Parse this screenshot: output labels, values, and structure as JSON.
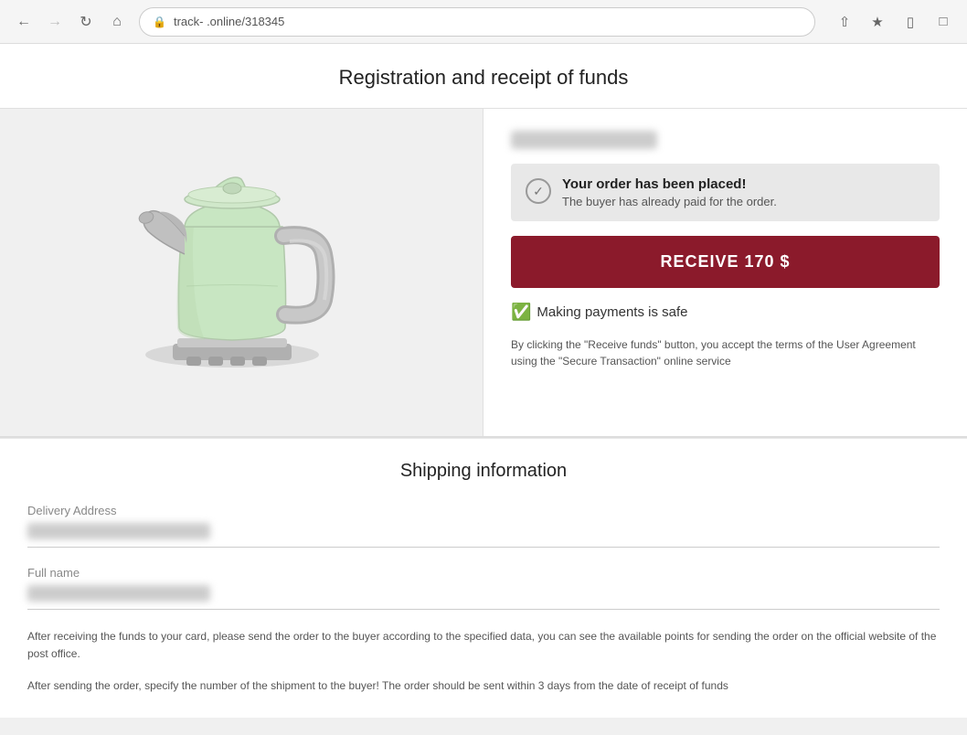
{
  "browser": {
    "url": "track-      .online/318345",
    "back_disabled": false,
    "forward_disabled": false
  },
  "page": {
    "title": "Registration and receipt of funds",
    "order": {
      "status_title": "Your order has been placed!",
      "status_subtitle": "The buyer has already paid for the order.",
      "receive_button": "RECEIVE 170 $",
      "safe_payment_label": "Making payments is safe",
      "disclaimer": "By clicking the \"Receive funds\" button, you accept the terms of the User Agreement using the \"Secure Transaction\" online service"
    },
    "shipping": {
      "section_title": "Shipping information",
      "delivery_address_label": "Delivery Address",
      "full_name_label": "Full name",
      "info_text_1": "After receiving the funds to your card, please send the order to the buyer according to the specified data, you can see the available points for sending the order on the official website of the post office.",
      "info_text_2": "After sending the order, specify the number of the shipment to the buyer! The order should be sent within 3 days from the date of receipt of funds"
    }
  }
}
